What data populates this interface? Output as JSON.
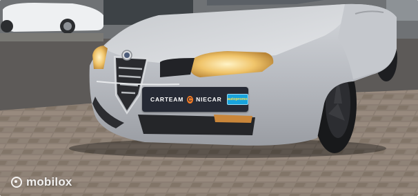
{
  "image": {
    "subject": "silver-coupe-front",
    "plate": {
      "left_word": "CARTEAM",
      "emblem_letter": "C",
      "right_word": "NIECAR",
      "badge_text": "autopromo"
    },
    "watermark": {
      "brand": "mobilox",
      "icon": "mobilox-ring-icon"
    },
    "colors": {
      "car_body": "#bcc0c6",
      "pavement": "#8a7d72",
      "plate": "#262a35",
      "brand_accent": "#f07a26",
      "headlight": "#f0c46a"
    }
  }
}
